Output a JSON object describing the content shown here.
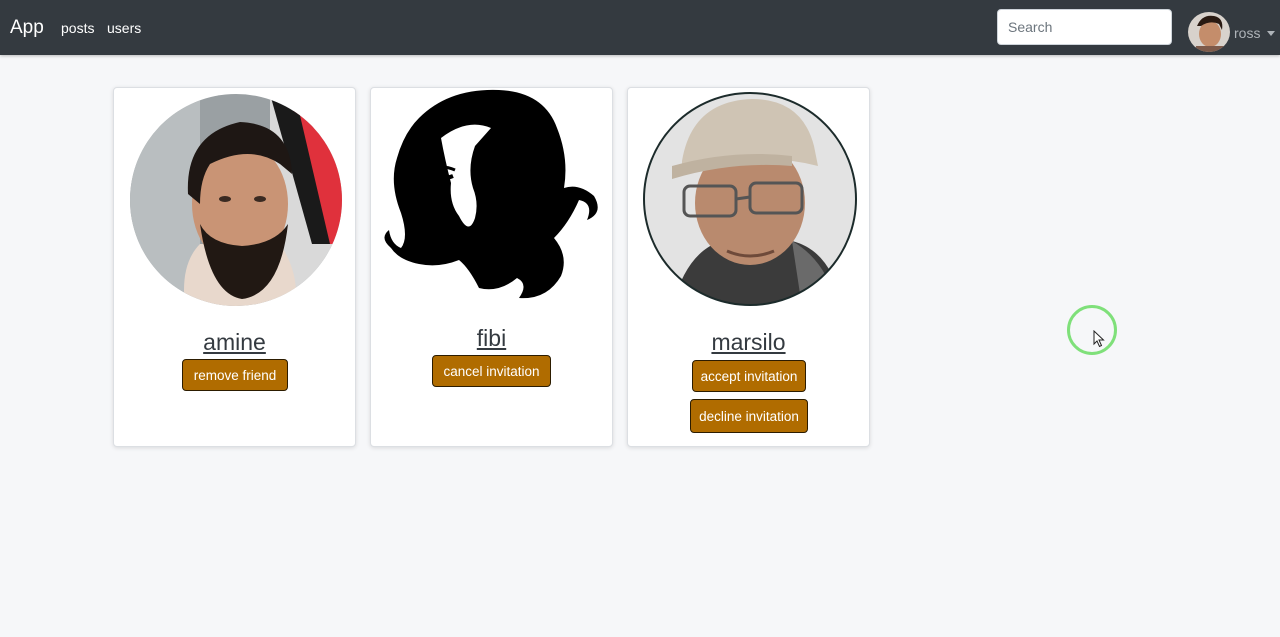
{
  "navbar": {
    "brand": "App",
    "links": [
      {
        "label": "posts"
      },
      {
        "label": "users"
      }
    ],
    "search": {
      "placeholder": "Search",
      "value": ""
    },
    "user": {
      "name": "ross"
    }
  },
  "cards": [
    {
      "name": "amine",
      "buttons": [
        {
          "label": "remove friend"
        }
      ]
    },
    {
      "name": "fibi",
      "buttons": [
        {
          "label": "cancel invitation"
        }
      ]
    },
    {
      "name": "marsilo",
      "buttons": [
        {
          "label": "accept invitation"
        },
        {
          "label": "decline invitation"
        }
      ]
    }
  ],
  "colors": {
    "navbar_bg": "#343a40",
    "page_bg": "#f6f7f9",
    "button_bg": "#b06c00",
    "cursor_ring": "#7fe07a"
  }
}
